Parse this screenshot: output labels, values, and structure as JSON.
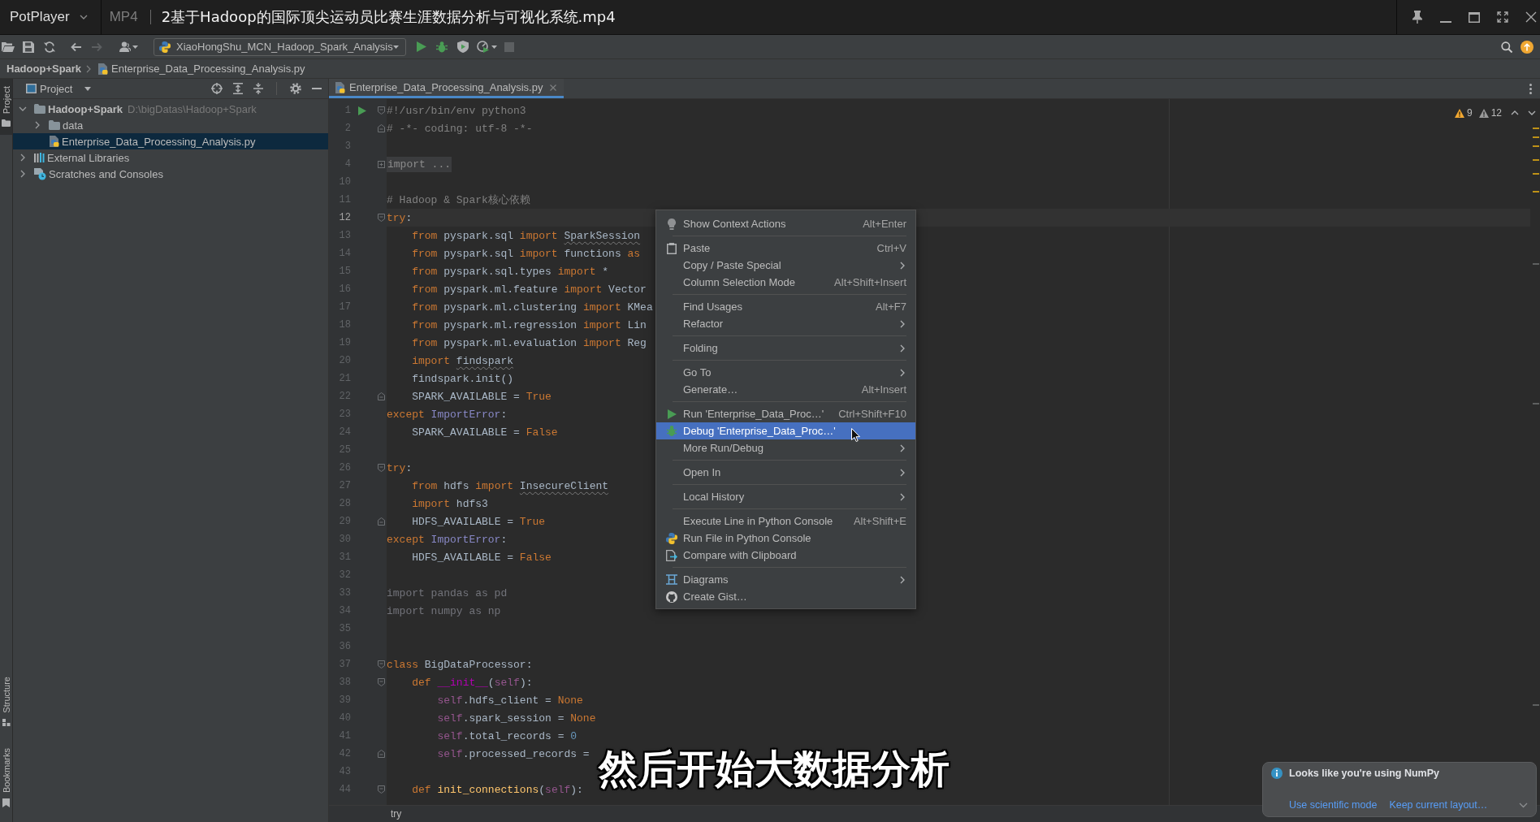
{
  "player": {
    "app_name": "PotPlayer",
    "format": "MP4",
    "title": "2基于Hadoop的国际顶尖运动员比赛生涯数据分析与可视化系统.mp4"
  },
  "toolbar": {
    "run_config": "XiaoHongShu_MCN_Hadoop_Spark_Analysis"
  },
  "navigation": {
    "breadcrumbs": [
      "Hadoop+Spark",
      "Enterprise_Data_Processing_Analysis.py"
    ]
  },
  "tool_stripe": {
    "top": [
      {
        "label": "Project",
        "kind": "project",
        "selected": true
      }
    ],
    "bottom": [
      {
        "label": "Structure",
        "kind": "structure",
        "selected": false
      },
      {
        "label": "Bookmarks",
        "kind": "bookmarks",
        "selected": false
      }
    ]
  },
  "project_panel": {
    "title": "Project",
    "tree": [
      {
        "label": "Hadoop+Spark",
        "detail": "D:\\bigDatas\\Hadoop+Spark",
        "kind": "project",
        "expanded": true,
        "selected": false,
        "children": [
          {
            "label": "data",
            "kind": "folder",
            "expanded": false,
            "selected": false
          },
          {
            "label": "Enterprise_Data_Processing_Analysis.py",
            "kind": "python-file",
            "selected": true
          }
        ]
      },
      {
        "label": "External Libraries",
        "kind": "libraries",
        "expanded": false,
        "selected": false
      },
      {
        "label": "Scratches and Consoles",
        "kind": "scratches",
        "expanded": false,
        "selected": false
      }
    ]
  },
  "editor": {
    "tabs": [
      {
        "label": "Enterprise_Data_Processing_Analysis.py",
        "selected": true
      }
    ],
    "inspections": {
      "warnings": "9",
      "weak_warnings": "12"
    },
    "lines": [
      {
        "number": "1",
        "current": false,
        "markers": [
          {
            "kind": "run"
          },
          {
            "kind": "fold-open"
          }
        ],
        "tokens": [
          {
            "text": "#!/usr/bin/env python3",
            "kind": "comment"
          }
        ]
      },
      {
        "number": "2",
        "current": false,
        "markers": [
          {
            "kind": "fold-close"
          }
        ],
        "tokens": [
          {
            "text": "# -*- coding: utf-8 -*-",
            "kind": "comment"
          }
        ]
      },
      {
        "number": "3",
        "current": false
      },
      {
        "number": "4",
        "current": false,
        "markers": [
          {
            "kind": "fold-collapsed"
          }
        ],
        "tokens": [
          {
            "text": "import ...",
            "kind": "folded"
          }
        ]
      },
      {
        "number": "10",
        "current": false
      },
      {
        "number": "11",
        "current": false,
        "tokens": [
          {
            "text": "# Hadoop & Spark核心依赖",
            "kind": "comment"
          }
        ]
      },
      {
        "number": "12",
        "current": true,
        "markers": [
          {
            "kind": "fold-open"
          }
        ],
        "tokens": [
          {
            "text": "try",
            "kind": "keyword"
          },
          {
            "text": ":",
            "kind": "text"
          }
        ]
      },
      {
        "number": "13",
        "current": false,
        "tokens": [
          {
            "text": "    from",
            "kind": "keyword"
          },
          {
            "text": " pyspark.sql ",
            "kind": "text"
          },
          {
            "text": "import ",
            "kind": "keyword"
          },
          {
            "text": "SparkSession",
            "kind": "unresolved"
          }
        ]
      },
      {
        "number": "14",
        "current": false,
        "tokens": [
          {
            "text": "    from",
            "kind": "keyword"
          },
          {
            "text": " pyspark.sql ",
            "kind": "text"
          },
          {
            "text": "import",
            "kind": "keyword"
          },
          {
            "text": " functions ",
            "kind": "text"
          },
          {
            "text": "as",
            "kind": "keyword"
          }
        ]
      },
      {
        "number": "15",
        "current": false,
        "tokens": [
          {
            "text": "    from",
            "kind": "keyword"
          },
          {
            "text": " pyspark.sql.types ",
            "kind": "text"
          },
          {
            "text": "import",
            "kind": "keyword"
          },
          {
            "text": " *",
            "kind": "text"
          }
        ]
      },
      {
        "number": "16",
        "current": false,
        "tokens": [
          {
            "text": "    from",
            "kind": "keyword"
          },
          {
            "text": " pyspark.ml.feature ",
            "kind": "text"
          },
          {
            "text": "import",
            "kind": "keyword"
          },
          {
            "text": " Vector",
            "kind": "text"
          }
        ]
      },
      {
        "number": "17",
        "current": false,
        "tokens": [
          {
            "text": "    from",
            "kind": "keyword"
          },
          {
            "text": " pyspark.ml.clustering ",
            "kind": "text"
          },
          {
            "text": "import",
            "kind": "keyword"
          },
          {
            "text": " KMea",
            "kind": "text"
          }
        ]
      },
      {
        "number": "18",
        "current": false,
        "tokens": [
          {
            "text": "    from",
            "kind": "keyword"
          },
          {
            "text": " pyspark.ml.regression ",
            "kind": "text"
          },
          {
            "text": "import",
            "kind": "keyword"
          },
          {
            "text": " Lin",
            "kind": "text"
          }
        ]
      },
      {
        "number": "19",
        "current": false,
        "tokens": [
          {
            "text": "    from",
            "kind": "keyword"
          },
          {
            "text": " pyspark.ml.evaluation ",
            "kind": "text"
          },
          {
            "text": "import",
            "kind": "keyword"
          },
          {
            "text": " Reg",
            "kind": "text"
          }
        ]
      },
      {
        "number": "20",
        "current": false,
        "tokens": [
          {
            "text": "    import ",
            "kind": "keyword"
          },
          {
            "text": "findspark",
            "kind": "unresolved"
          }
        ]
      },
      {
        "number": "21",
        "current": false,
        "tokens": [
          {
            "text": "    findspark.init()",
            "kind": "text"
          }
        ]
      },
      {
        "number": "22",
        "current": false,
        "markers": [
          {
            "kind": "fold-close"
          }
        ],
        "tokens": [
          {
            "text": "    SPARK_AVAILABLE = ",
            "kind": "text"
          },
          {
            "text": "True",
            "kind": "keyword"
          }
        ]
      },
      {
        "number": "23",
        "current": false,
        "tokens": [
          {
            "text": "except ",
            "kind": "keyword"
          },
          {
            "text": "ImportError",
            "kind": "builtin"
          },
          {
            "text": ":",
            "kind": "text"
          }
        ]
      },
      {
        "number": "24",
        "current": false,
        "tokens": [
          {
            "text": "    SPARK_AVAILABLE = ",
            "kind": "text"
          },
          {
            "text": "False",
            "kind": "keyword"
          }
        ]
      },
      {
        "number": "25",
        "current": false
      },
      {
        "number": "26",
        "current": false,
        "markers": [
          {
            "kind": "fold-open"
          }
        ],
        "tokens": [
          {
            "text": "try",
            "kind": "keyword"
          },
          {
            "text": ":",
            "kind": "text"
          }
        ]
      },
      {
        "number": "27",
        "current": false,
        "tokens": [
          {
            "text": "    from",
            "kind": "keyword"
          },
          {
            "text": " hdfs ",
            "kind": "text"
          },
          {
            "text": "import ",
            "kind": "keyword"
          },
          {
            "text": "InsecureClient",
            "kind": "unresolved"
          }
        ]
      },
      {
        "number": "28",
        "current": false,
        "tokens": [
          {
            "text": "    import",
            "kind": "keyword"
          },
          {
            "text": " hdfs3",
            "kind": "text"
          }
        ]
      },
      {
        "number": "29",
        "current": false,
        "markers": [
          {
            "kind": "fold-close"
          }
        ],
        "tokens": [
          {
            "text": "    HDFS_AVAILABLE = ",
            "kind": "text"
          },
          {
            "text": "True",
            "kind": "keyword"
          }
        ]
      },
      {
        "number": "30",
        "current": false,
        "tokens": [
          {
            "text": "except ",
            "kind": "keyword"
          },
          {
            "text": "ImportError",
            "kind": "builtin"
          },
          {
            "text": ":",
            "kind": "text"
          }
        ]
      },
      {
        "number": "31",
        "current": false,
        "tokens": [
          {
            "text": "    HDFS_AVAILABLE = ",
            "kind": "text"
          },
          {
            "text": "False",
            "kind": "keyword"
          }
        ]
      },
      {
        "number": "32",
        "current": false
      },
      {
        "number": "33",
        "current": false,
        "tokens": [
          {
            "text": "import pandas as pd",
            "kind": "unused"
          }
        ]
      },
      {
        "number": "34",
        "current": false,
        "tokens": [
          {
            "text": "import numpy as np",
            "kind": "unused"
          }
        ]
      },
      {
        "number": "35",
        "current": false
      },
      {
        "number": "36",
        "current": false
      },
      {
        "number": "37",
        "current": false,
        "markers": [
          {
            "kind": "fold-open"
          }
        ],
        "tokens": [
          {
            "text": "class ",
            "kind": "keyword"
          },
          {
            "text": "BigDataProcessor:",
            "kind": "text"
          }
        ]
      },
      {
        "number": "38",
        "current": false,
        "markers": [
          {
            "kind": "fold-open"
          }
        ],
        "tokens": [
          {
            "text": "    def ",
            "kind": "keyword"
          },
          {
            "text": "__init__",
            "kind": "magic"
          },
          {
            "text": "(",
            "kind": "text"
          },
          {
            "text": "self",
            "kind": "self"
          },
          {
            "text": "):",
            "kind": "text"
          }
        ]
      },
      {
        "number": "39",
        "current": false,
        "tokens": [
          {
            "text": "        self",
            "kind": "self"
          },
          {
            "text": ".hdfs_client = ",
            "kind": "text"
          },
          {
            "text": "None",
            "kind": "keyword"
          }
        ]
      },
      {
        "number": "40",
        "current": false,
        "tokens": [
          {
            "text": "        self",
            "kind": "self"
          },
          {
            "text": ".spark_session = ",
            "kind": "text"
          },
          {
            "text": "None",
            "kind": "keyword"
          }
        ]
      },
      {
        "number": "41",
        "current": false,
        "tokens": [
          {
            "text": "        self",
            "kind": "self"
          },
          {
            "text": ".total_records = ",
            "kind": "text"
          },
          {
            "text": "0",
            "kind": "number"
          }
        ]
      },
      {
        "number": "42",
        "current": false,
        "markers": [
          {
            "kind": "fold-close"
          }
        ],
        "tokens": [
          {
            "text": "        self",
            "kind": "self"
          },
          {
            "text": ".processed_records =",
            "kind": "text"
          }
        ]
      },
      {
        "number": "43",
        "current": false
      },
      {
        "number": "44",
        "current": false,
        "markers": [
          {
            "kind": "fold-open"
          }
        ],
        "tokens": [
          {
            "text": "    def ",
            "kind": "keyword"
          },
          {
            "text": "init_connections",
            "kind": "function"
          },
          {
            "text": "(",
            "kind": "text"
          },
          {
            "text": "self",
            "kind": "self"
          },
          {
            "text": "):",
            "kind": "text"
          }
        ]
      }
    ],
    "breadcrumb": "try"
  },
  "context_menu": {
    "groups": [
      {
        "items": [
          {
            "label": "Show Context Actions",
            "shortcut": "Alt+Enter",
            "kind": "bulb",
            "submenu": false,
            "selected": false
          }
        ]
      },
      {
        "items": [
          {
            "label": "Paste",
            "shortcut": "Ctrl+V",
            "kind": "clipboard",
            "submenu": false,
            "selected": false
          },
          {
            "label": "Copy / Paste Special",
            "kind": "plain",
            "submenu": true,
            "selected": false
          },
          {
            "label": "Column Selection Mode",
            "shortcut": "Alt+Shift+Insert",
            "kind": "plain",
            "submenu": false,
            "selected": false
          }
        ]
      },
      {
        "items": [
          {
            "label": "Find Usages",
            "shortcut": "Alt+F7",
            "kind": "plain",
            "submenu": false,
            "selected": false
          },
          {
            "label": "Refactor",
            "kind": "plain",
            "submenu": true,
            "selected": false
          }
        ]
      },
      {
        "items": [
          {
            "label": "Folding",
            "kind": "plain",
            "submenu": true,
            "selected": false
          }
        ]
      },
      {
        "items": [
          {
            "label": "Go To",
            "kind": "plain",
            "submenu": true,
            "selected": false
          },
          {
            "label": "Generate…",
            "shortcut": "Alt+Insert",
            "kind": "plain",
            "submenu": false,
            "selected": false
          }
        ]
      },
      {
        "items": [
          {
            "label": "Run 'Enterprise_Data_Proc…'",
            "shortcut": "Ctrl+Shift+F10",
            "kind": "run",
            "submenu": false,
            "selected": false
          },
          {
            "label": "Debug 'Enterprise_Data_Proc…'",
            "kind": "debug",
            "submenu": false,
            "selected": true
          },
          {
            "label": "More Run/Debug",
            "kind": "plain",
            "submenu": true,
            "selected": false
          }
        ]
      },
      {
        "items": [
          {
            "label": "Open In",
            "kind": "plain",
            "submenu": true,
            "selected": false
          }
        ]
      },
      {
        "items": [
          {
            "label": "Local History",
            "kind": "plain",
            "submenu": true,
            "selected": false
          }
        ]
      },
      {
        "items": [
          {
            "label": "Execute Line in Python Console",
            "shortcut": "Alt+Shift+E",
            "kind": "plain",
            "submenu": false,
            "selected": false
          },
          {
            "label": "Run File in Python Console",
            "kind": "python",
            "submenu": false,
            "selected": false
          },
          {
            "label": "Compare with Clipboard",
            "kind": "compare",
            "submenu": false,
            "selected": false
          }
        ]
      },
      {
        "items": [
          {
            "label": "Diagrams",
            "kind": "diagram",
            "submenu": true,
            "selected": false
          },
          {
            "label": "Create Gist…",
            "kind": "gist",
            "submenu": false,
            "selected": false
          }
        ]
      }
    ]
  },
  "notification": {
    "title": "Looks like you're using NumPy",
    "links": [
      "Use scientific mode",
      "Keep current layout…"
    ]
  },
  "subtitle": "然后开始大数据分析"
}
